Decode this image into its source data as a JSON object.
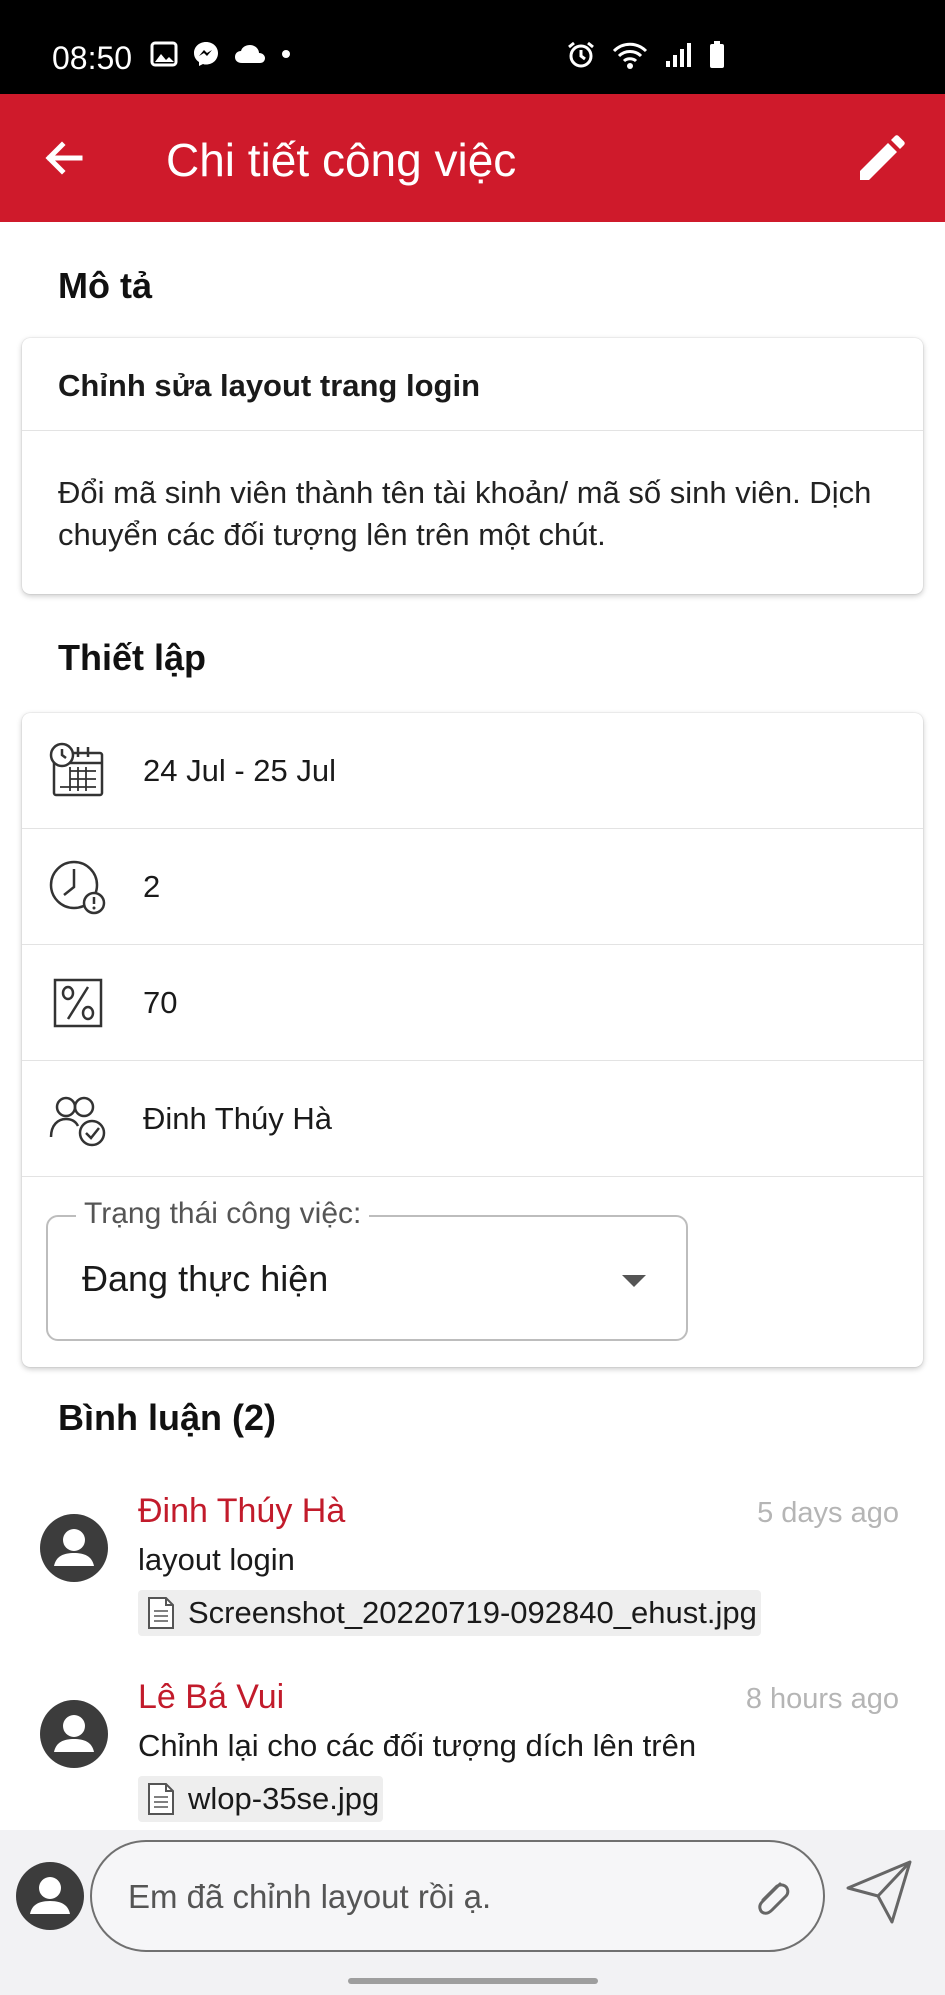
{
  "status_bar": {
    "time": "08:50",
    "left_icons": [
      "image-icon",
      "messenger-icon",
      "cloud-icon",
      "dot-icon"
    ],
    "right_icons": [
      "alarm-icon",
      "wifi-icon",
      "signal-icon",
      "battery-icon"
    ]
  },
  "app_bar": {
    "title": "Chi tiết công việc",
    "background": "#cf1a2b",
    "left_icon": "back-arrow-icon",
    "right_icon": "edit-pencil-icon"
  },
  "description": {
    "heading": "Mô tả",
    "title": "Chỉnh sửa layout trang login",
    "body": "Đổi mã sinh viên thành tên tài khoản/ mã số sinh viên. Dịch chuyển các đối tượng lên trên một chút."
  },
  "settings": {
    "heading": "Thiết lập",
    "rows": [
      {
        "icon": "calendar-clock-icon",
        "value": "24 Jul - 25 Jul"
      },
      {
        "icon": "clock-alert-icon",
        "value": "2"
      },
      {
        "icon": "percent-icon",
        "value": "70"
      },
      {
        "icon": "people-check-icon",
        "value": "Đinh Thúy Hà"
      }
    ],
    "status": {
      "label": "Trạng thái công việc:",
      "value": "Đang thực hiện"
    }
  },
  "comments": {
    "heading": "Bình luận (2)",
    "items": [
      {
        "author": "Đinh Thúy Hà",
        "time": "5 days ago",
        "text": "layout login",
        "attachment": "Screenshot_20220719-092840_ehust.jpg"
      },
      {
        "author": "Lê Bá Vui",
        "time": "8 hours ago",
        "text": "Chỉnh lại cho các đối tượng dích lên trên",
        "attachment": "wlop-35se.jpg"
      }
    ],
    "accent": "#c21b2b"
  },
  "input": {
    "placeholder": "Em đã chỉnh layout rồi ạ.",
    "attach_icon": "paperclip-icon",
    "send_icon": "send-icon"
  }
}
